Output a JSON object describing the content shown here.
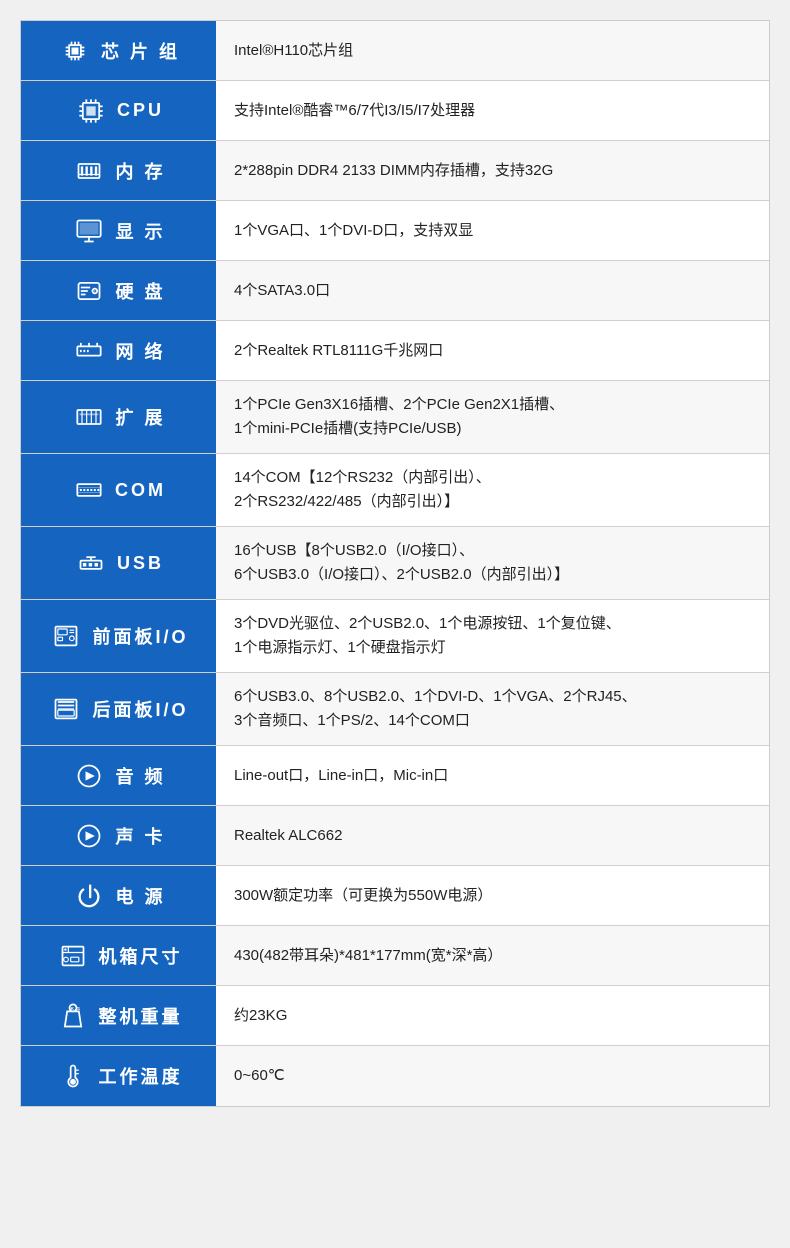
{
  "rows": [
    {
      "id": "chipset",
      "icon_type": "svg_chipset",
      "label": "芯 片 组",
      "value": "Intel®H110芯片组"
    },
    {
      "id": "cpu",
      "icon_type": "svg_cpu",
      "label": "CPU",
      "label_spacing": "wide",
      "value": "支持Intel®酷睿™6/7代I3/I5/I7处理器"
    },
    {
      "id": "memory",
      "icon_type": "svg_memory",
      "label": "内  存",
      "value": "2*288pin DDR4 2133 DIMM内存插槽，支持32G"
    },
    {
      "id": "display",
      "icon_type": "svg_display",
      "label": "显  示",
      "value": "1个VGA口、1个DVI-D口，支持双显"
    },
    {
      "id": "hdd",
      "icon_type": "svg_hdd",
      "label": "硬  盘",
      "value": "4个SATA3.0口"
    },
    {
      "id": "network",
      "icon_type": "svg_network",
      "label": "网  络",
      "value": "2个Realtek RTL8111G千兆网口"
    },
    {
      "id": "expansion",
      "icon_type": "svg_expansion",
      "label": "扩  展",
      "value": "1个PCIe Gen3X16插槽、2个PCIe Gen2X1插槽、\n1个mini-PCIe插槽(支持PCIe/USB)"
    },
    {
      "id": "com",
      "icon_type": "svg_com",
      "label": "COM",
      "value": "14个COM【12个RS232（内部引出）、\n2个RS232/422/485（内部引出）】"
    },
    {
      "id": "usb",
      "icon_type": "svg_usb",
      "label": "USB",
      "value": "16个USB【8个USB2.0（I/O接口）、\n6个USB3.0（I/O接口）、2个USB2.0（内部引出）】"
    },
    {
      "id": "front_io",
      "icon_type": "svg_front",
      "label": "前面板I/O",
      "value": "3个DVD光驱位、2个USB2.0、1个电源按钮、1个复位键、\n1个电源指示灯、1个硬盘指示灯"
    },
    {
      "id": "rear_io",
      "icon_type": "svg_rear",
      "label": "后面板I/O",
      "value": "6个USB3.0、8个USB2.0、1个DVI-D、1个VGA、2个RJ45、\n3个音频口、1个PS/2、14个COM口"
    },
    {
      "id": "audio",
      "icon_type": "svg_audio",
      "label": "音  频",
      "value": "Line-out口，Line-in口，Mic-in口"
    },
    {
      "id": "soundcard",
      "icon_type": "svg_soundcard",
      "label": "声  卡",
      "value": "Realtek ALC662"
    },
    {
      "id": "power",
      "icon_type": "svg_power",
      "label": "电  源",
      "value": "300W额定功率（可更换为550W电源）"
    },
    {
      "id": "casesize",
      "icon_type": "svg_case",
      "label": "机箱尺寸",
      "value": "430(482带耳朵)*481*177mm(宽*深*高）"
    },
    {
      "id": "weight",
      "icon_type": "svg_weight",
      "label": "整机重量",
      "value": "约23KG"
    },
    {
      "id": "temperature",
      "icon_type": "svg_temp",
      "label": "工作温度",
      "value": "0~60℃"
    }
  ]
}
